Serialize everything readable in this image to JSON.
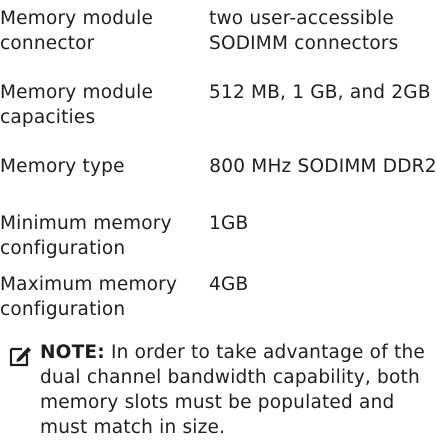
{
  "specs": [
    {
      "label": "Memory module connector",
      "value": "two user-accessible SODIMM connectors"
    },
    {
      "label": "Memory module capacities",
      "value": "512 MB, 1 GB, and 2GB"
    },
    {
      "label": "Memory type",
      "value": "800 MHz SODIMM DDR2"
    },
    {
      "label": "Minimum memory configuration",
      "value": "1GB"
    },
    {
      "label": "Maximum memory configuration",
      "value": "4GB"
    }
  ],
  "note": {
    "icon": "note-pencil-icon",
    "label": "NOTE:",
    "text": "In order to take advantage of the dual channel bandwidth capability, both memory slots must be populated and must match in size."
  }
}
